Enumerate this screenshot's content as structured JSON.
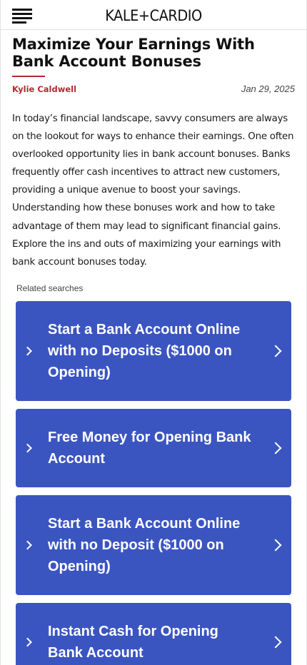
{
  "header": {
    "logo": "KALE+CARDIO"
  },
  "article": {
    "title": "Maximize Your Earnings With Bank Account Bonuses",
    "author": "Kylie Caldwell",
    "date": "Jan 29, 2025",
    "intro": "In today’s financial landscape, savvy consumers are always on the lookout for ways to enhance their earnings. One often overlooked opportunity lies in bank account bonuses. Banks frequently offer cash incentives to attract new customers, providing a unique avenue to boost your savings. Understanding how these bonuses work and how to take advantage of them may lead to significant financial gains. Explore the ins and outs of maximizing your earnings with bank account bonuses today."
  },
  "related": {
    "label": "Related searches",
    "items": [
      {
        "label": "Start a Bank Account Online with no Deposits ($1000 on Opening)"
      },
      {
        "label": "Free Money for Opening Bank Account"
      },
      {
        "label": "Start a Bank Account Online with no Deposit ($1000 on Opening)"
      },
      {
        "label": "Instant Cash for Opening Bank Account"
      }
    ]
  },
  "colors": {
    "accent": "#b5282f",
    "card_background": "#3b55c0"
  },
  "icons": {
    "menu": "hamburger-menu-icon",
    "card_chevron": "chevron-right-icon"
  }
}
